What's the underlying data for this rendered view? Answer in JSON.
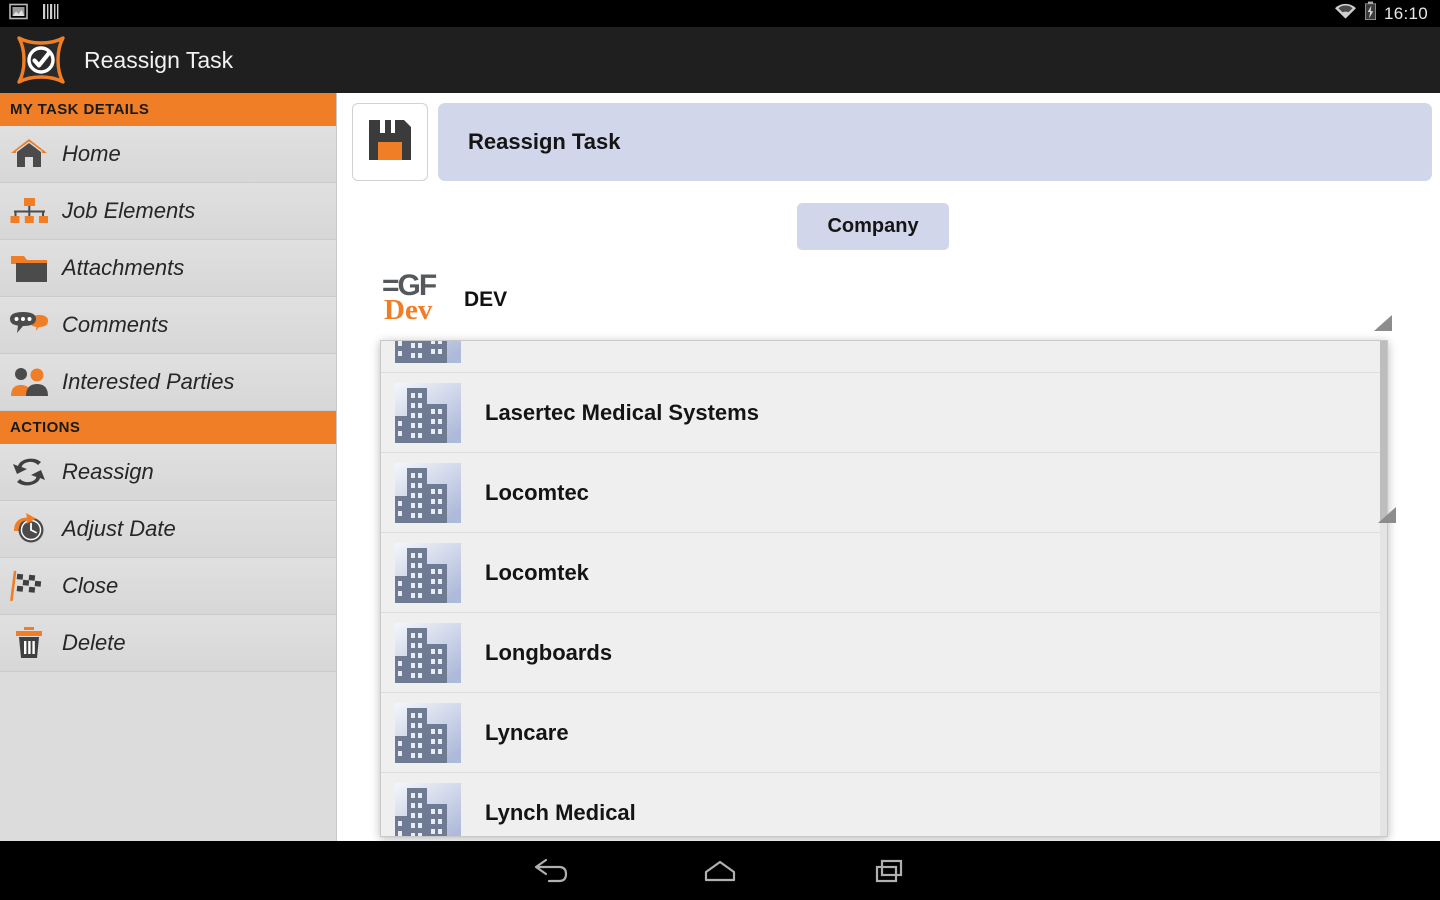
{
  "statusbar": {
    "clock": "16:10",
    "icons": [
      "screenshot-icon",
      "barcode-icon",
      "wifi-icon",
      "battery-charging-icon"
    ]
  },
  "actionbar": {
    "app_icon": "task-check-logo-icon",
    "title": "Reassign Task"
  },
  "sidebar": {
    "sections": [
      {
        "header": "MY TASK DETAILS",
        "items": [
          {
            "label": "Home",
            "icon": "home-icon"
          },
          {
            "label": "Job Elements",
            "icon": "org-chart-icon"
          },
          {
            "label": "Attachments",
            "icon": "folder-icon"
          },
          {
            "label": "Comments",
            "icon": "speech-bubbles-icon"
          },
          {
            "label": "Interested Parties",
            "icon": "people-icon"
          }
        ]
      },
      {
        "header": "ACTIONS",
        "items": [
          {
            "label": "Reassign",
            "icon": "reassign-arrows-icon"
          },
          {
            "label": "Adjust Date",
            "icon": "clock-arrow-icon"
          },
          {
            "label": "Close",
            "icon": "checkered-flag-icon"
          },
          {
            "label": "Delete",
            "icon": "trash-icon"
          }
        ]
      }
    ]
  },
  "main": {
    "save_button_icon": "floppy-disk-save-icon",
    "title_value": "Reassign Task",
    "company_button_label": "Company",
    "selected": {
      "logo": "egf-dev-logo",
      "logo_text_top": "=GF",
      "logo_text_bottom": "Dev",
      "name": "DEV"
    }
  },
  "dropdown": {
    "items": [
      {
        "label": "",
        "icon": "building-icon"
      },
      {
        "label": "Lasertec Medical Systems",
        "icon": "building-icon"
      },
      {
        "label": "Locomtec",
        "icon": "building-icon"
      },
      {
        "label": "Locomtek",
        "icon": "building-icon"
      },
      {
        "label": "Longboards",
        "icon": "building-icon"
      },
      {
        "label": "Lyncare",
        "icon": "building-icon"
      },
      {
        "label": "Lynch Medical",
        "icon": "building-icon"
      }
    ]
  },
  "navbar": {
    "buttons": [
      {
        "name": "back-icon"
      },
      {
        "name": "home-icon"
      },
      {
        "name": "recents-icon"
      }
    ]
  },
  "colors": {
    "accent_orange": "#f07e26",
    "actionbar_dark": "#1f1f1f",
    "sidebar_gray": "#dcdcdc",
    "field_lavender": "#d2d6ea",
    "list_bg": "#efefef"
  }
}
